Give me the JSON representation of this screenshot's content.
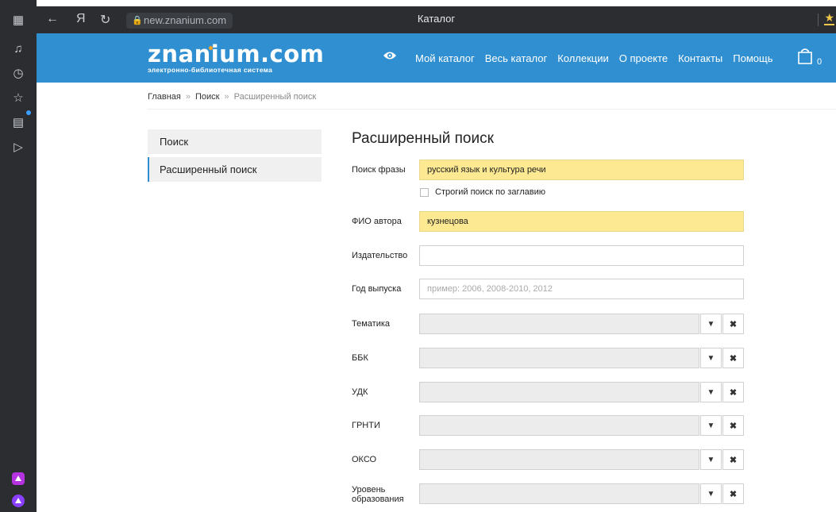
{
  "browser": {
    "url": "new.znanium.com",
    "tab_title": "Каталог"
  },
  "site": {
    "logo_text": "znanium.com",
    "logo_sub": "электронно-библиотечная система",
    "menu": [
      "Мой каталог",
      "Весь каталог",
      "Коллекции",
      "О проекте",
      "Контакты",
      "Помощь"
    ],
    "cart_count": "0"
  },
  "breadcrumb": {
    "home": "Главная",
    "search": "Поиск",
    "current": "Расширенный поиск"
  },
  "side_menu": {
    "items": [
      "Поиск",
      "Расширенный поиск"
    ]
  },
  "form": {
    "title": "Расширенный поиск",
    "phrase_label": "Поиск фразы",
    "phrase_value": "русский язык и культура речи",
    "strict_label": "Строгий поиск по заглавию",
    "author_label": "ФИО автора",
    "author_value": "кузнецова",
    "publisher_label": "Издательство",
    "year_label": "Год выпуска",
    "year_placeholder": "пример: 2006, 2008-2010, 2012",
    "topic_label": "Тематика",
    "bbk_label": "ББК",
    "udk_label": "УДК",
    "grnti_label": "ГРНТИ",
    "okso_label": "ОКСО",
    "edu_level_label": "Уровень образования"
  },
  "icons": {
    "dropdown": "caret-down-icon",
    "clear": "clear-x-icon"
  },
  "colors": {
    "header_bg": "#2f8fd1",
    "highlight_input": "#fde992",
    "logo_dot": "#f5a623"
  }
}
